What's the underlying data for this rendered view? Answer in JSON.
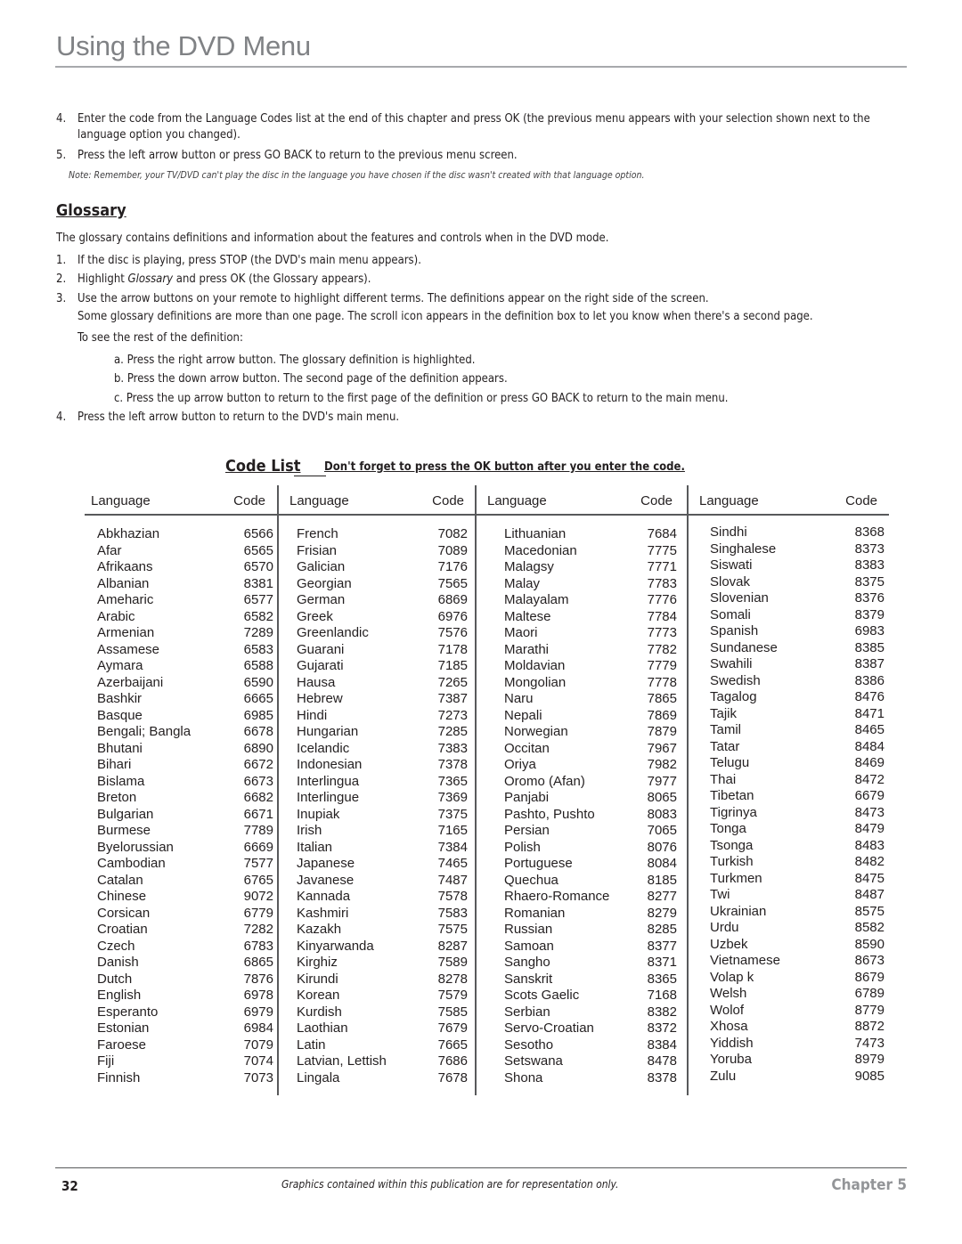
{
  "header": {
    "title": "Using the DVD Menu"
  },
  "intro_steps": [
    {
      "num": "4.",
      "text": "Enter the code from the Language Codes list at the end of this chapter and press OK (the previous menu appears with your selection shown next to the language option you changed)."
    },
    {
      "num": "5.",
      "text": "Press the left arrow button or press GO BACK to return to the previous menu screen."
    }
  ],
  "note": "Note: Remember, your TV/DVD can't play the disc in the language you have chosen if the disc wasn't created with that language option.",
  "glossary": {
    "heading": "Glossary",
    "intro": "The glossary contains definitions and information about the features and controls when in the DVD mode.",
    "steps": [
      {
        "num": "1.",
        "text": "If the disc is playing, press STOP (the DVD's main menu appears)."
      },
      {
        "num": "2.",
        "text_before": "Highlight ",
        "text_italic": "Glossary",
        "text_after": " and press OK (the Glossary appears)."
      },
      {
        "num": "3.",
        "text": "Use the arrow buttons on your remote to highlight different terms. The definitions appear on the right side of the screen."
      }
    ],
    "step3_extra": "Some glossary definitions are more than one page. The scroll icon appears in the definition box to let you know when there's a second page.",
    "step3_lead": "To see the rest of the definition:",
    "substeps": [
      "a. Press the right arrow button. The glossary definition is highlighted.",
      "b. Press the down arrow button. The second page of the definition appears.",
      "c. Press the up arrow button to return to the first page of the definition or press GO BACK to return to the main menu."
    ],
    "step4": {
      "num": "4.",
      "text": "Press the left arrow button to return to the DVD's main menu."
    }
  },
  "code_list": {
    "title": "Code List",
    "note": "Don't forget to press the OK button after you enter the code.",
    "header_language": "Language",
    "header_code": "Code",
    "columns": [
      [
        [
          "Abkhazian",
          "6566"
        ],
        [
          "Afar",
          "6565"
        ],
        [
          "Afrikaans",
          "6570"
        ],
        [
          "Albanian",
          "8381"
        ],
        [
          "Ameharic",
          "6577"
        ],
        [
          "Arabic",
          "6582"
        ],
        [
          "Armenian",
          "7289"
        ],
        [
          "Assamese",
          "6583"
        ],
        [
          "Aymara",
          "6588"
        ],
        [
          "Azerbaijani",
          "6590"
        ],
        [
          "Bashkir",
          "6665"
        ],
        [
          "Basque",
          "6985"
        ],
        [
          "Bengali; Bangla",
          "6678"
        ],
        [
          "Bhutani",
          "6890"
        ],
        [
          "Bihari",
          "6672"
        ],
        [
          "Bislama",
          "6673"
        ],
        [
          "Breton",
          "6682"
        ],
        [
          "Bulgarian",
          "6671"
        ],
        [
          "Burmese",
          "7789"
        ],
        [
          "Byelorussian",
          "6669"
        ],
        [
          "Cambodian",
          "7577"
        ],
        [
          "Catalan",
          "6765"
        ],
        [
          "Chinese",
          "9072"
        ],
        [
          "Corsican",
          "6779"
        ],
        [
          "Croatian",
          "7282"
        ],
        [
          "Czech",
          "6783"
        ],
        [
          "Danish",
          "6865"
        ],
        [
          "Dutch",
          "7876"
        ],
        [
          "English",
          "6978"
        ],
        [
          "Esperanto",
          "6979"
        ],
        [
          "Estonian",
          "6984"
        ],
        [
          "Faroese",
          "7079"
        ],
        [
          "Fiji",
          "7074"
        ],
        [
          "Finnish",
          "7073"
        ]
      ],
      [
        [
          "French",
          "7082"
        ],
        [
          "Frisian",
          "7089"
        ],
        [
          "Galician",
          "7176"
        ],
        [
          "Georgian",
          "7565"
        ],
        [
          "German",
          "6869"
        ],
        [
          "Greek",
          "6976"
        ],
        [
          "Greenlandic",
          "7576"
        ],
        [
          "Guarani",
          "7178"
        ],
        [
          "Gujarati",
          "7185"
        ],
        [
          "Hausa",
          "7265"
        ],
        [
          "Hebrew",
          "7387"
        ],
        [
          "Hindi",
          "7273"
        ],
        [
          "Hungarian",
          "7285"
        ],
        [
          "Icelandic",
          "7383"
        ],
        [
          "Indonesian",
          "7378"
        ],
        [
          "Interlingua",
          "7365"
        ],
        [
          "Interlingue",
          "7369"
        ],
        [
          "Inupiak",
          "7375"
        ],
        [
          "Irish",
          "7165"
        ],
        [
          "Italian",
          "7384"
        ],
        [
          "Japanese",
          "7465"
        ],
        [
          "Javanese",
          "7487"
        ],
        [
          "Kannada",
          "7578"
        ],
        [
          "Kashmiri",
          "7583"
        ],
        [
          "Kazakh",
          "7575"
        ],
        [
          "Kinyarwanda",
          "8287"
        ],
        [
          "Kirghiz",
          "7589"
        ],
        [
          "Kirundi",
          "8278"
        ],
        [
          "Korean",
          "7579"
        ],
        [
          "Kurdish",
          "7585"
        ],
        [
          "Laothian",
          "7679"
        ],
        [
          "Latin",
          "7665"
        ],
        [
          "Latvian, Lettish",
          "7686"
        ],
        [
          "Lingala",
          "7678"
        ]
      ],
      [
        [
          "Lithuanian",
          "7684"
        ],
        [
          "Macedonian",
          "7775"
        ],
        [
          "Malagsy",
          "7771"
        ],
        [
          "Malay",
          "7783"
        ],
        [
          "Malayalam",
          "7776"
        ],
        [
          "Maltese",
          "7784"
        ],
        [
          "Maori",
          "7773"
        ],
        [
          "Marathi",
          "7782"
        ],
        [
          "Moldavian",
          "7779"
        ],
        [
          "Mongolian",
          "7778"
        ],
        [
          "Naru",
          "7865"
        ],
        [
          "Nepali",
          "7869"
        ],
        [
          "Norwegian",
          "7879"
        ],
        [
          "Occitan",
          "7967"
        ],
        [
          "Oriya",
          "7982"
        ],
        [
          "Oromo (Afan)",
          "7977"
        ],
        [
          "Panjabi",
          "8065"
        ],
        [
          "Pashto, Pushto",
          "8083"
        ],
        [
          "Persian",
          "7065"
        ],
        [
          "Polish",
          "8076"
        ],
        [
          "Portuguese",
          "8084"
        ],
        [
          "Quechua",
          "8185"
        ],
        [
          "Rhaero-Romance",
          "8277"
        ],
        [
          "Romanian",
          "8279"
        ],
        [
          "Russian",
          "8285"
        ],
        [
          "Samoan",
          "8377"
        ],
        [
          "Sangho",
          "8371"
        ],
        [
          "Sanskrit",
          "8365"
        ],
        [
          "Scots Gaelic",
          "7168"
        ],
        [
          "Serbian",
          "8382"
        ],
        [
          "Servo-Croatian",
          "8372"
        ],
        [
          "Sesotho",
          "8384"
        ],
        [
          "Setswana",
          "8478"
        ],
        [
          "Shona",
          "8378"
        ]
      ],
      [
        [
          "Sindhi",
          "8368"
        ],
        [
          "Singhalese",
          "8373"
        ],
        [
          "Siswati",
          "8383"
        ],
        [
          "Slovak",
          "8375"
        ],
        [
          "Slovenian",
          "8376"
        ],
        [
          "Somali",
          "8379"
        ],
        [
          "Spanish",
          "6983"
        ],
        [
          "Sundanese",
          "8385"
        ],
        [
          "Swahili",
          "8387"
        ],
        [
          "Swedish",
          "8386"
        ],
        [
          "Tagalog",
          "8476"
        ],
        [
          "Tajik",
          "8471"
        ],
        [
          "Tamil",
          "8465"
        ],
        [
          "Tatar",
          "8484"
        ],
        [
          "Telugu",
          "8469"
        ],
        [
          "Thai",
          "8472"
        ],
        [
          "Tibetan",
          "6679"
        ],
        [
          "Tigrinya",
          "8473"
        ],
        [
          "Tonga",
          "8479"
        ],
        [
          "Tsonga",
          "8483"
        ],
        [
          "Turkish",
          "8482"
        ],
        [
          "Turkmen",
          "8475"
        ],
        [
          "Twi",
          "8487"
        ],
        [
          "Ukrainian",
          "8575"
        ],
        [
          "Urdu",
          "8582"
        ],
        [
          "Uzbek",
          "8590"
        ],
        [
          "Vietnamese",
          "8673"
        ],
        [
          "Volap k",
          "8679"
        ],
        [
          "Welsh",
          "6789"
        ],
        [
          "Wolof",
          "8779"
        ],
        [
          "Xhosa",
          "8872"
        ],
        [
          "Yiddish",
          "7473"
        ],
        [
          "Yoruba",
          "8979"
        ],
        [
          "Zulu",
          "9085"
        ]
      ]
    ]
  },
  "footer": {
    "page_number": "32",
    "note": "Graphics contained within this publication are for representation only.",
    "chapter": "Chapter 5"
  }
}
